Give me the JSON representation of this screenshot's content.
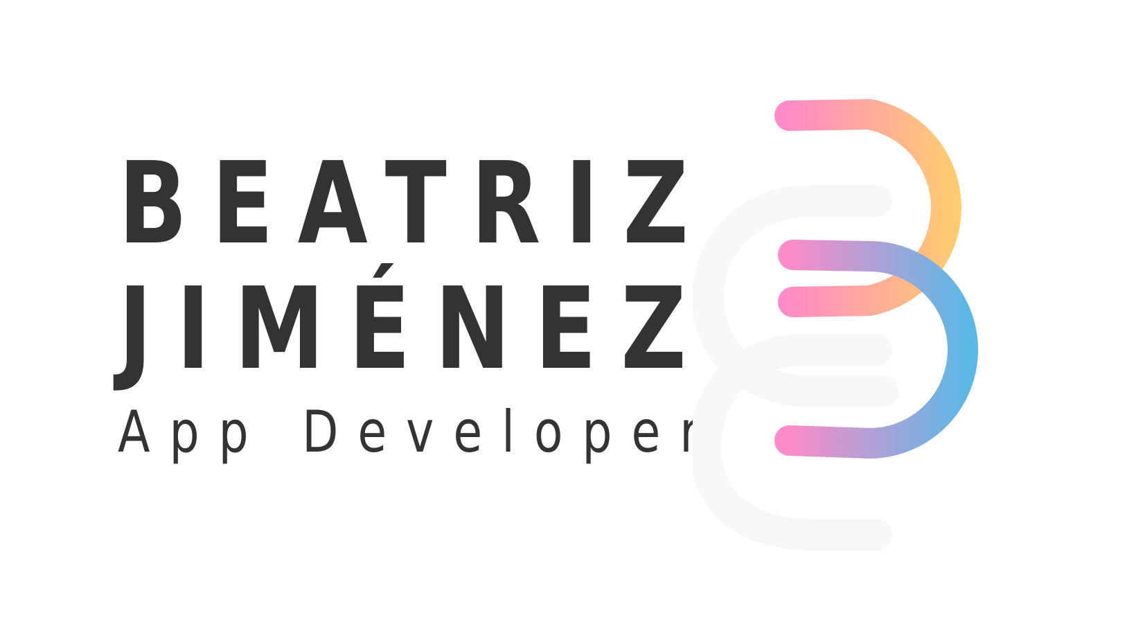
{
  "brand": {
    "first_name": "BEATRIZ",
    "last_name": "JIMÉNEZ",
    "role": "App Developer"
  },
  "logo": {
    "icon": "letter-b-monogram-icon",
    "upper_gradient": [
      "#FF8AC8",
      "#FFD06A"
    ],
    "lower_gradient": [
      "#FF8AC8",
      "#5CB8E6"
    ],
    "ghost_color": "#F7F8F8"
  },
  "colors": {
    "text": "#333333",
    "background": "#FFFFFF"
  }
}
